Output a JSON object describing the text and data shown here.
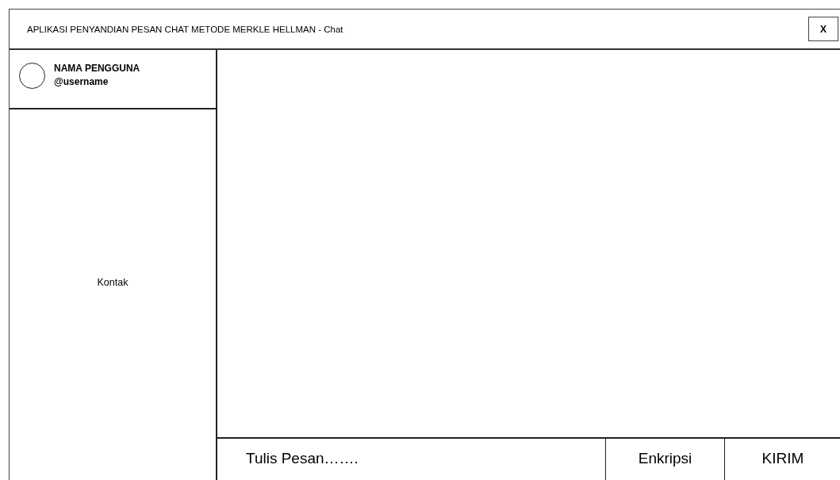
{
  "window": {
    "title": "APLIKASI PENYANDIAN PESAN CHAT METODE MERKLE HELLMAN - Chat",
    "close": "X"
  },
  "profile": {
    "name": "NAMA PENGGUNA",
    "username": "@username"
  },
  "contacts": {
    "label": "Kontak"
  },
  "composer": {
    "placeholder": "Tulis Pesan…….",
    "buttons": [
      "Enkripsi",
      "KIRIM"
    ]
  }
}
